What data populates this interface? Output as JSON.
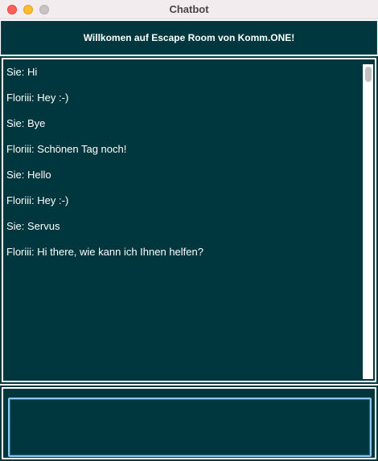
{
  "window": {
    "title": "Chatbot"
  },
  "header": {
    "banner_text": "Willkomen auf Escape Room von Komm.ONE!"
  },
  "chat": {
    "messages": [
      "Sie: Hi",
      "Floriii: Hey :-)",
      "Sie: Bye",
      "Floriii: Schönen Tag noch!",
      "Sie: Hello",
      "Floriii: Hey :-)",
      "Sie: Servus",
      "Floriii: Hi there, wie kann ich Ihnen helfen?"
    ]
  },
  "input": {
    "value": "",
    "placeholder": ""
  },
  "colors": {
    "background": "#00373e",
    "text": "#ffffff",
    "input_focus_border": "#8ec5ee",
    "titlebar": "#f3ecef"
  }
}
